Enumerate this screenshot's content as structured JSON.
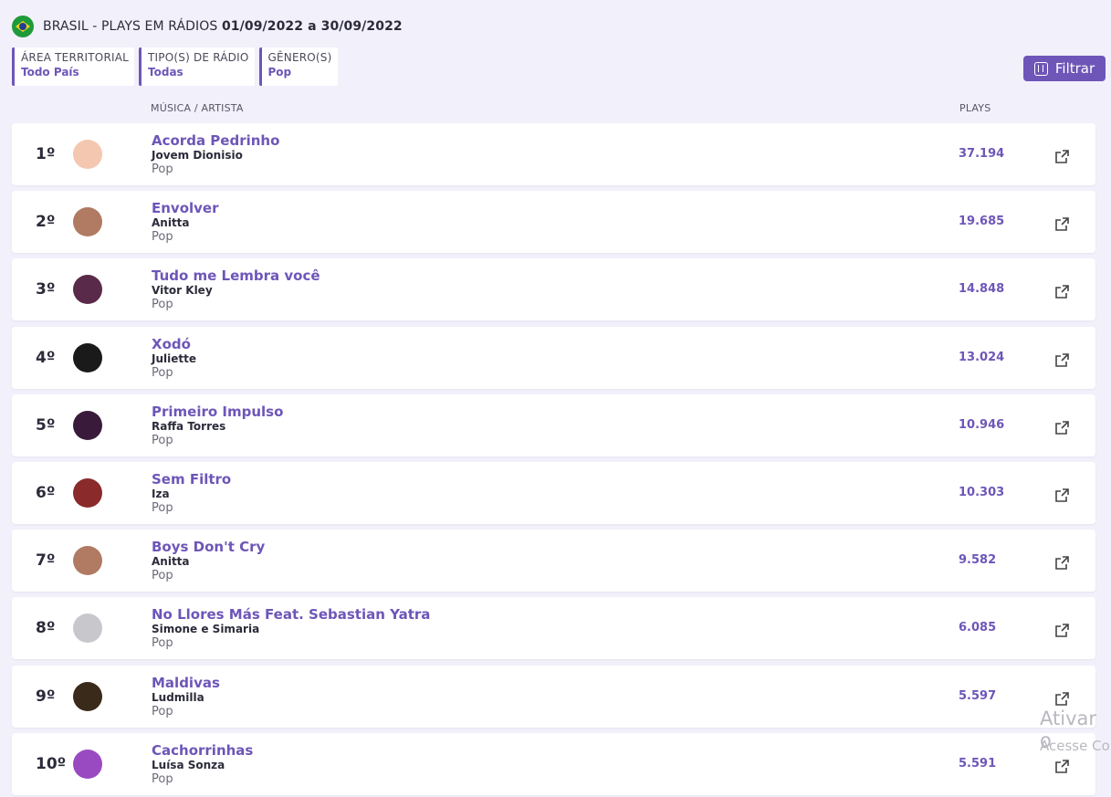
{
  "header": {
    "title_prefix": "BRASIL - PLAYS EM RÁDIOS",
    "date_range": "01/09/2022 a 30/09/2022"
  },
  "filters": [
    {
      "label": "ÁREA TERRITORIAL",
      "value": "Todo País"
    },
    {
      "label": "TIPO(S) DE RÁDIO",
      "value": "Todas"
    },
    {
      "label": "GÊNERO(S)",
      "value": "Pop"
    }
  ],
  "filter_button": {
    "label": "Filtrar"
  },
  "columns": {
    "song_artist": "MÚSICA / ARTISTA",
    "plays": "PLAYS"
  },
  "rows": [
    {
      "rank": "1º",
      "song": "Acorda Pedrinho",
      "artist": "Jovem Dionisio",
      "genre": "Pop",
      "plays": "37.194"
    },
    {
      "rank": "2º",
      "song": "Envolver",
      "artist": "Anitta",
      "genre": "Pop",
      "plays": "19.685"
    },
    {
      "rank": "3º",
      "song": "Tudo me Lembra você",
      "artist": "Vitor Kley",
      "genre": "Pop",
      "plays": "14.848"
    },
    {
      "rank": "4º",
      "song": "Xodó",
      "artist": "Juliette",
      "genre": "Pop",
      "plays": "13.024"
    },
    {
      "rank": "5º",
      "song": "Primeiro Impulso",
      "artist": "Raffa Torres",
      "genre": "Pop",
      "plays": "10.946"
    },
    {
      "rank": "6º",
      "song": "Sem Filtro",
      "artist": "Iza",
      "genre": "Pop",
      "plays": "10.303"
    },
    {
      "rank": "7º",
      "song": "Boys Don't Cry",
      "artist": "Anitta",
      "genre": "Pop",
      "plays": "9.582"
    },
    {
      "rank": "8º",
      "song": "No Llores Más Feat. Sebastian Yatra",
      "artist": "Simone e Simaria",
      "genre": "Pop",
      "plays": "6.085"
    },
    {
      "rank": "9º",
      "song": "Maldivas",
      "artist": "Ludmilla",
      "genre": "Pop",
      "plays": "5.597"
    },
    {
      "rank": "10º",
      "song": "Cachorrinhas",
      "artist": "Luísa Sonza",
      "genre": "Pop",
      "plays": "5.591"
    }
  ],
  "watermark": {
    "line1": "Ativar o",
    "line2": "Acesse Co"
  },
  "colors": {
    "accent": "#6d56b8",
    "background": "#f2f0fb",
    "avatars": [
      "#f4c7b0",
      "#b07a63",
      "#5a2a4a",
      "#1a1a1a",
      "#3a1a3a",
      "#8a2a2a",
      "#b07a63",
      "#c8c8cc",
      "#3a2a1a",
      "#9a4ac0"
    ]
  }
}
